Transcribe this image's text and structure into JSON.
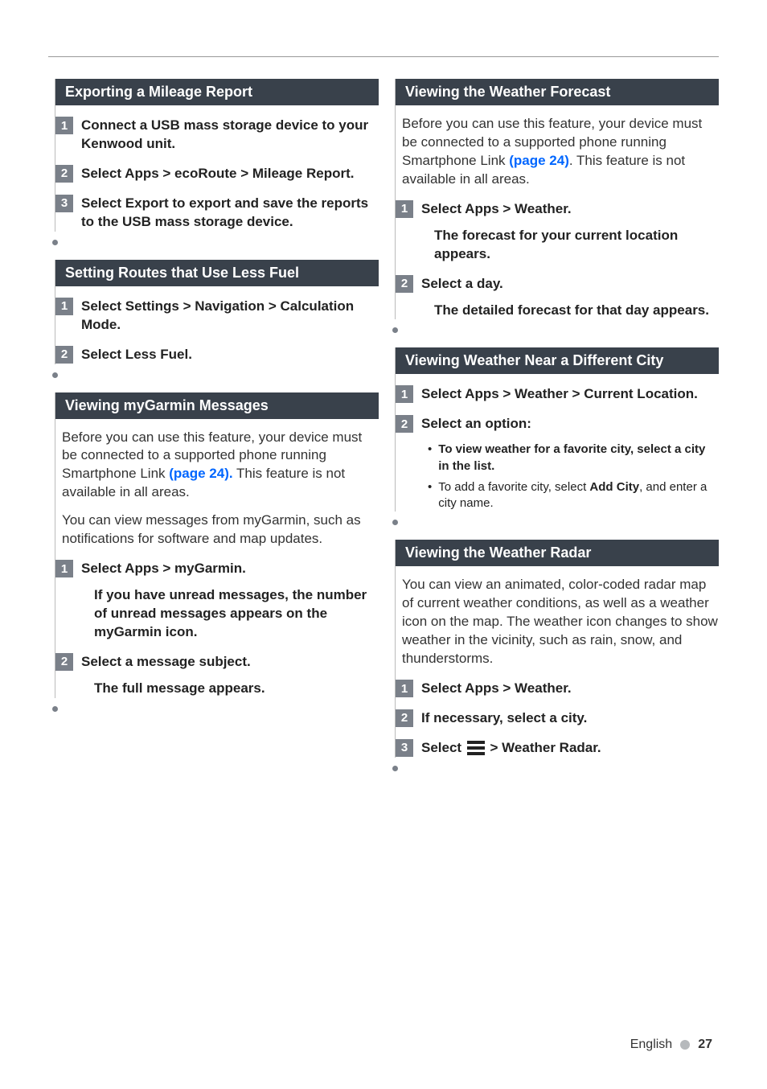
{
  "left": {
    "s1": {
      "title": "Exporting a Mileage Report",
      "step1": "Connect a USB mass storage device to your Kenwood unit.",
      "step2": "Select Apps > ecoRoute > Mileage Report.",
      "step3": "Select Export to export and save the reports to the USB mass storage device."
    },
    "s2": {
      "title": "Setting Routes that Use Less Fuel",
      "step1": "Select Settings > Navigation > Calculation Mode.",
      "step2": "Select Less Fuel."
    },
    "s3": {
      "title": "Viewing myGarmin Messages",
      "intro_a": "Before you can use this feature, your device must be connected to a supported phone running Smartphone Link ",
      "link": "(page 24).",
      "intro_b": " This feature is not available in all areas.",
      "intro2": "You can view messages from myGarmin, such as notifications for software and map updates.",
      "step1": "Select Apps > myGarmin.",
      "note1": "If you have unread messages, the number of unread messages appears on the myGarmin icon.",
      "step2": "Select a message subject.",
      "note2": "The full message appears."
    }
  },
  "right": {
    "s1": {
      "title": "Viewing the Weather Forecast",
      "intro_a": "Before you can use this feature, your device must be connected to a supported phone running Smartphone Link ",
      "link": "(page 24)",
      "intro_b": ". This feature is not available in all areas.",
      "step1": "Select Apps > Weather.",
      "note1": "The forecast for your current location appears.",
      "step2": "Select a day.",
      "note2": "The detailed forecast for that day appears."
    },
    "s2": {
      "title": "Viewing Weather Near a Different City",
      "step1": "Select Apps > Weather > Current Location.",
      "step2": "Select an option:",
      "b1_a": "To view weather for a favorite city, select a city in the list.",
      "b2_a": "To add a favorite city, select ",
      "b2_bold": "Add City",
      "b2_b": ", and enter a city name."
    },
    "s3": {
      "title": "Viewing the Weather Radar",
      "intro": "You can view an animated, color-coded radar map of current weather conditions, as well as a weather icon on the map. The weather icon changes to show weather in the vicinity, such as rain, snow, and thunderstorms.",
      "step1": "Select Apps > Weather.",
      "step2": "If necessary, select a city.",
      "step3_a": "Select ",
      "step3_b": " > Weather Radar."
    }
  },
  "footer": {
    "lang": "English",
    "page": "27"
  },
  "nums": {
    "n1": "1",
    "n2": "2",
    "n3": "3"
  }
}
